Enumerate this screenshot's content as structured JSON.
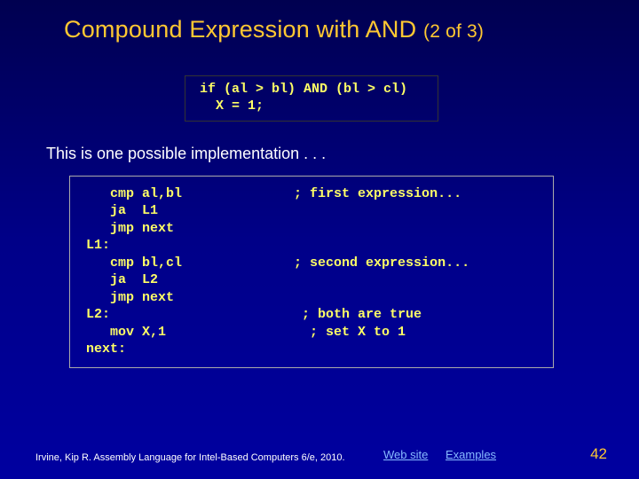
{
  "title": {
    "main": "Compound Expression with AND",
    "sub": "(2 of 3)"
  },
  "pseudo": {
    "line1": "if (al > bl) AND (bl > cl)",
    "line2": "  X = 1;"
  },
  "intro": "This is one possible implementation . . .",
  "code": "   cmp al,bl              ; first expression...\n   ja  L1\n   jmp next\nL1:\n   cmp bl,cl              ; second expression...\n   ja  L2\n   jmp next\nL2:                        ; both are true\n   mov X,1                  ; set X to 1\nnext:",
  "footer": {
    "credit": "Irvine, Kip R. Assembly Language for Intel-Based Computers 6/e, 2010.",
    "link_website": "Web site",
    "link_examples": "Examples",
    "slide_number": "42"
  }
}
